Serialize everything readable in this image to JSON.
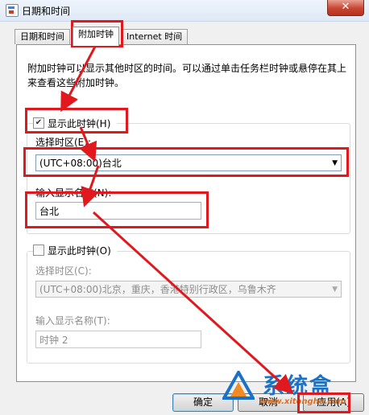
{
  "window": {
    "title": "日期和时间",
    "close_glyph": "✕"
  },
  "tabs": [
    {
      "label": "日期和时间",
      "active": false
    },
    {
      "label": "附加时钟",
      "active": true
    },
    {
      "label": "Internet 时间",
      "active": false
    }
  ],
  "description": "附加时钟可以显示其他时区的时间。可以通过单击任务栏时钟或悬停在其上来查看这些附加时钟。",
  "clock1": {
    "checkbox_label": "显示此时钟(H)",
    "checked": true,
    "timezone_label": "选择时区(E):",
    "timezone_value": "(UTC+08:00)台北",
    "name_label": "输入显示名称(N):",
    "name_value": "台北"
  },
  "clock2": {
    "checkbox_label": "显示此时钟(O)",
    "checked": false,
    "timezone_label": "选择时区(C):",
    "timezone_value": "(UTC+08:00)北京，重庆，香港特别行政区，乌鲁木齐",
    "name_label": "输入显示名称(T):",
    "name_value": "时钟 2"
  },
  "buttons": {
    "ok": "确定",
    "cancel": "取消",
    "apply": "应用(A)"
  },
  "watermark": {
    "brand": "系统盒",
    "url": "www.xitonghe.com"
  },
  "annotation_color": "#e0191e"
}
